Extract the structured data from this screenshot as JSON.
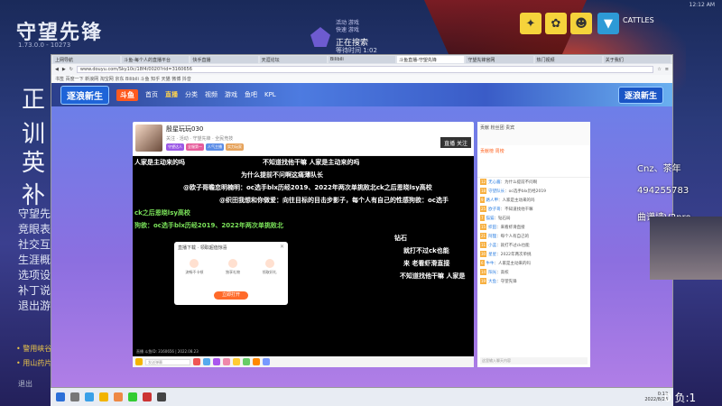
{
  "game": {
    "logo": "守望先锋",
    "version": "1.73.0.0 - 10273",
    "big_lines": [
      "正",
      "训",
      "英",
      "补"
    ],
    "menu_lines": [
      "守望先",
      "竞眼表",
      "社交互",
      "生涯概",
      "选项设",
      "补丁说",
      "退出游"
    ],
    "yellow_lines": [
      "• 警用峡谷",
      "• 用山药片"
    ],
    "bottom_left": "退出"
  },
  "top_overlay": {
    "queue_small_1": "活动 游戏",
    "queue_small_2": "快速 游戏",
    "queue_title": "正在搜索",
    "queue_time": "等待时间 1:02",
    "cattles": "CATTLES",
    "clock": "12:12 AM"
  },
  "browser": {
    "tabs": [
      "上网导航",
      "斗鱼-每个人的直播平台",
      "快手直播",
      "天涯论坛",
      "Bilibili",
      "斗鱼直播-守望先锋",
      "守望先锋官网",
      "热门视频",
      "关于我们"
    ],
    "url": "www.douyu.com/Sky10c/18f4/0020?rid=3160656",
    "bookmarks": "书签  百度一下  新浪网  淘宝网  京东  Bilibili  斗鱼  知乎  天猫  微博  抖音"
  },
  "site": {
    "event_logo": "逐浪新生",
    "brand": "斗鱼",
    "nav": [
      "首页",
      "直播",
      "分类",
      "视频",
      "游戏",
      "鱼吧",
      "KPL"
    ],
    "header_right": "逐浪新生"
  },
  "player": {
    "streamer_name": "殷星玩玩030",
    "sub_info": "关注 · 活动 · 守望先锋 · 全民竞技",
    "tags": [
      "守望达人",
      "全服第一",
      "人气主播",
      "实力玩家"
    ],
    "follow_label": "直播 关注",
    "status": "直播  斗鱼ID: 3160656 | 2022.08.23",
    "danmu": [
      "人家是主动来的吗",
      "不知道找他干嘛 人家是主动来的吗",
      "为什么提前不问啊这痛薄队长",
      "@欧子哥瞻恋明楠明：oc选手blx历经2019、2022年两次单挑败北ck之后恩晓lsy高校",
      "@织田我想和你做爱：向往目标的目击步影子，每个人有自己的性感狗欲：oc选手",
      "ck之后恩晓lsy高校",
      "狗欲：oc选手blx历经2019、2022年两次单挑败北",
      "钻石",
      "就打不过ck也能",
      "来 老看虾滑直接",
      "不知道找他干嘛 人家是"
    ],
    "send_placeholder": "发送弹幕"
  },
  "dialog": {
    "title": "直播下载 · 领取超值惊喜",
    "items": [
      "流畅不卡顿",
      "独享礼物",
      "领取好礼"
    ],
    "button": "立即打开"
  },
  "chat": {
    "header": "贡献 粉丝团 贵宾",
    "rank": "贡献榜 周榜",
    "lines": [
      {
        "lv": "12",
        "name": "无心酱",
        "text": "为什么提前不问啊"
      },
      {
        "lv": "18",
        "name": "守望队长",
        "text": "oc选手blx历经2019"
      },
      {
        "lv": "9",
        "name": "路人甲",
        "text": "人家是主动来的吗"
      },
      {
        "lv": "25",
        "name": "欧子哥",
        "text": "不知道找他干嘛"
      },
      {
        "lv": "7",
        "name": "猫猫",
        "text": "钻石局"
      },
      {
        "lv": "15",
        "name": "织田",
        "text": "来看虾滑直接"
      },
      {
        "lv": "21",
        "name": "阿狸",
        "text": "每个人有自己的"
      },
      {
        "lv": "11",
        "name": "小蓝",
        "text": "就打不过ck也能"
      },
      {
        "lv": "30",
        "name": "星星",
        "text": "2022年两次单挑"
      },
      {
        "lv": "6",
        "name": "牛牛",
        "text": "人家是主动来的吗"
      },
      {
        "lv": "14",
        "name": "阳光",
        "text": "高校"
      },
      {
        "lv": "19",
        "name": "大鱼",
        "text": "守望先锋"
      }
    ],
    "input_placeholder": "这里输入聊天内容"
  },
  "streamer_overlay": {
    "line1": "Cnz、茶年",
    "line2": "494255783",
    "line3": "曲谱墙V2pro",
    "score": "0 负:1"
  },
  "taskbar": {
    "time": "0:12",
    "date": "2022/8/23"
  },
  "colors": {
    "accent": "#ff6a2a",
    "brand_blue": "#2b3f8c",
    "danmu_green": "#7be35a"
  }
}
